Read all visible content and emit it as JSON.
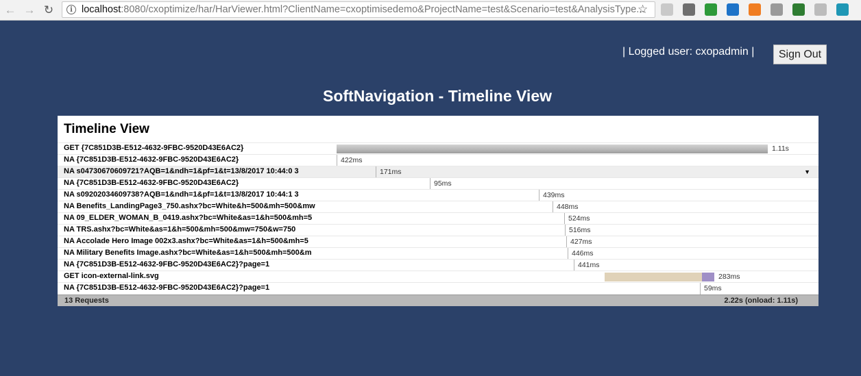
{
  "browser": {
    "url_host": "localhost",
    "url_rest": ":8080/cxoptimize/har/HarViewer.html?ClientName=cxoptimisedemo&ProjectName=test&Scenario=test&AnalysisType...",
    "extensions": [
      {
        "name": "ext-1-icon",
        "color": "#c9c9c9"
      },
      {
        "name": "ext-2-icon",
        "color": "#6f6f6f"
      },
      {
        "name": "ext-3-icon",
        "color": "#2e9a3a"
      },
      {
        "name": "ext-beta-icon",
        "color": "#1e73c8"
      },
      {
        "name": "ext-5-icon",
        "color": "#f07d22"
      },
      {
        "name": "ext-v-icon",
        "color": "#9a9a9a"
      },
      {
        "name": "ext-7-icon",
        "color": "#2f7d32"
      },
      {
        "name": "ext-angular-icon",
        "color": "#bcbcbc"
      },
      {
        "name": "ext-9-icon",
        "color": "#1f97b5"
      }
    ]
  },
  "header": {
    "logged_user": "| Logged user: cxopadmin |",
    "signout_label": "Sign Out"
  },
  "page_title": "SoftNavigation - Timeline View",
  "panel_title": "Timeline View",
  "rows": [
    {
      "label": "GET {7C851D3B-E512-4632-9FBC-9520D43E6AC2}",
      "time": "1.11s",
      "start": 0,
      "duration": 1.11,
      "bar": "gray",
      "highlighted": false
    },
    {
      "label": "NA {7C851D3B-E512-4632-9FBC-9520D43E6AC2}",
      "time": "422ms",
      "start": 0,
      "duration": 0,
      "bar": "none",
      "highlighted": false
    },
    {
      "label": "NA s04730670609721?AQB=1&ndh=1&pf=1&t=13/8/2017 10:44:0 3",
      "time": "171ms",
      "start": 0.1,
      "duration": 0,
      "bar": "none",
      "highlighted": true
    },
    {
      "label": "NA {7C851D3B-E512-4632-9FBC-9520D43E6AC2}",
      "time": "95ms",
      "start": 0.24,
      "duration": 0,
      "bar": "none",
      "highlighted": false
    },
    {
      "label": "NA s09202034609738?AQB=1&ndh=1&pf=1&t=13/8/2017 10:44:1 3",
      "time": "439ms",
      "start": 0.52,
      "duration": 0,
      "bar": "none",
      "highlighted": false
    },
    {
      "label": "NA Benefits_LandingPage3_750.ashx?bc=White&h=500&mh=500&mw",
      "time": "448ms",
      "start": 0.555,
      "duration": 0,
      "bar": "none",
      "highlighted": false
    },
    {
      "label": "NA 09_ELDER_WOMAN_B_0419.ashx?bc=White&as=1&h=500&mh=5",
      "time": "524ms",
      "start": 0.585,
      "duration": 0,
      "bar": "none",
      "highlighted": false
    },
    {
      "label": "NA TRS.ashx?bc=White&as=1&h=500&mh=500&mw=750&w=750",
      "time": "516ms",
      "start": 0.588,
      "duration": 0,
      "bar": "none",
      "highlighted": false
    },
    {
      "label": "NA Accolade Hero Image 002x3.ashx?bc=White&as=1&h=500&mh=5",
      "time": "427ms",
      "start": 0.59,
      "duration": 0,
      "bar": "none",
      "highlighted": false
    },
    {
      "label": "NA Military Benefits Image.ashx?bc=White&as=1&h=500&mh=500&m",
      "time": "446ms",
      "start": 0.595,
      "duration": 0,
      "bar": "none",
      "highlighted": false
    },
    {
      "label": "NA {7C851D3B-E512-4632-9FBC-9520D43E6AC2}?page=1",
      "time": "441ms",
      "start": 0.61,
      "duration": 0,
      "bar": "none",
      "highlighted": false
    },
    {
      "label": "GET icon-external-link.svg",
      "time": "283ms",
      "start": 0.69,
      "duration": 0.283,
      "bar": "beige",
      "highlighted": false
    },
    {
      "label": "NA {7C851D3B-E512-4632-9FBC-9520D43E6AC2}?page=1",
      "time": "59ms",
      "start": 0.935,
      "duration": 0,
      "bar": "none",
      "highlighted": false
    }
  ],
  "summary": {
    "count": "13 Requests",
    "total": "2.22s (onload: 1.11s)"
  },
  "colors": {
    "background": "#2b4169",
    "bar_gray": "#b6b6b6",
    "bar_beige": "#e0d2b8",
    "bar_purple": "#9f8fc6"
  }
}
